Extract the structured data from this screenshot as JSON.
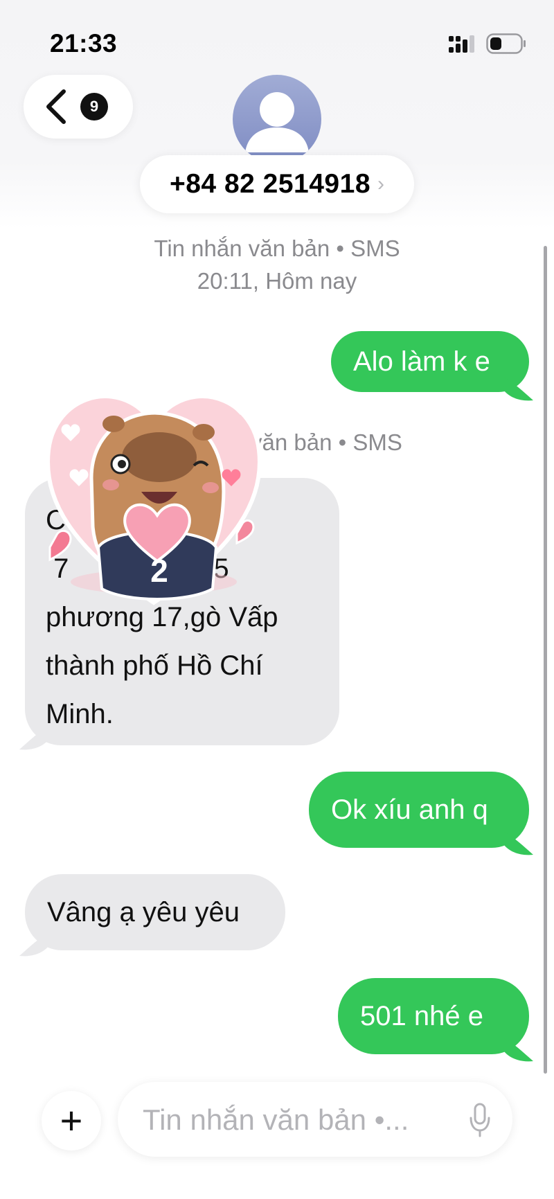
{
  "status_bar": {
    "time": "21:33"
  },
  "header": {
    "unread_count": "9",
    "contact_number": "+84 82 2514918",
    "contact_chevron": "›"
  },
  "thread": {
    "meta1_line1": "Tin nhắn văn bản • SMS",
    "meta1_line2": "20:11, Hôm nay",
    "meta2_visible": "văn bản • SMS",
    "messages": [
      {
        "from": "me",
        "text": "Alo làm k e"
      },
      {
        "from": "them",
        "lines": [
          "C          Hotel",
          " 7           g số 5",
          "phương 17,gò Vấp",
          "thành phố Hồ Chí",
          "Minh."
        ]
      },
      {
        "from": "me",
        "text": "Ok xíu anh q"
      },
      {
        "from": "them",
        "text": "Vâng ạ yêu yêu"
      },
      {
        "from": "me",
        "text": "501 nhé e"
      }
    ],
    "sticker_name": "capybara-heart-sticker"
  },
  "composer": {
    "placeholder": "Tin nhắn văn bản •...",
    "plus_label": "+"
  },
  "colors": {
    "outgoing_bubble": "#34c759",
    "incoming_bubble": "#e9e9eb",
    "meta_text": "#8a8a8e"
  }
}
